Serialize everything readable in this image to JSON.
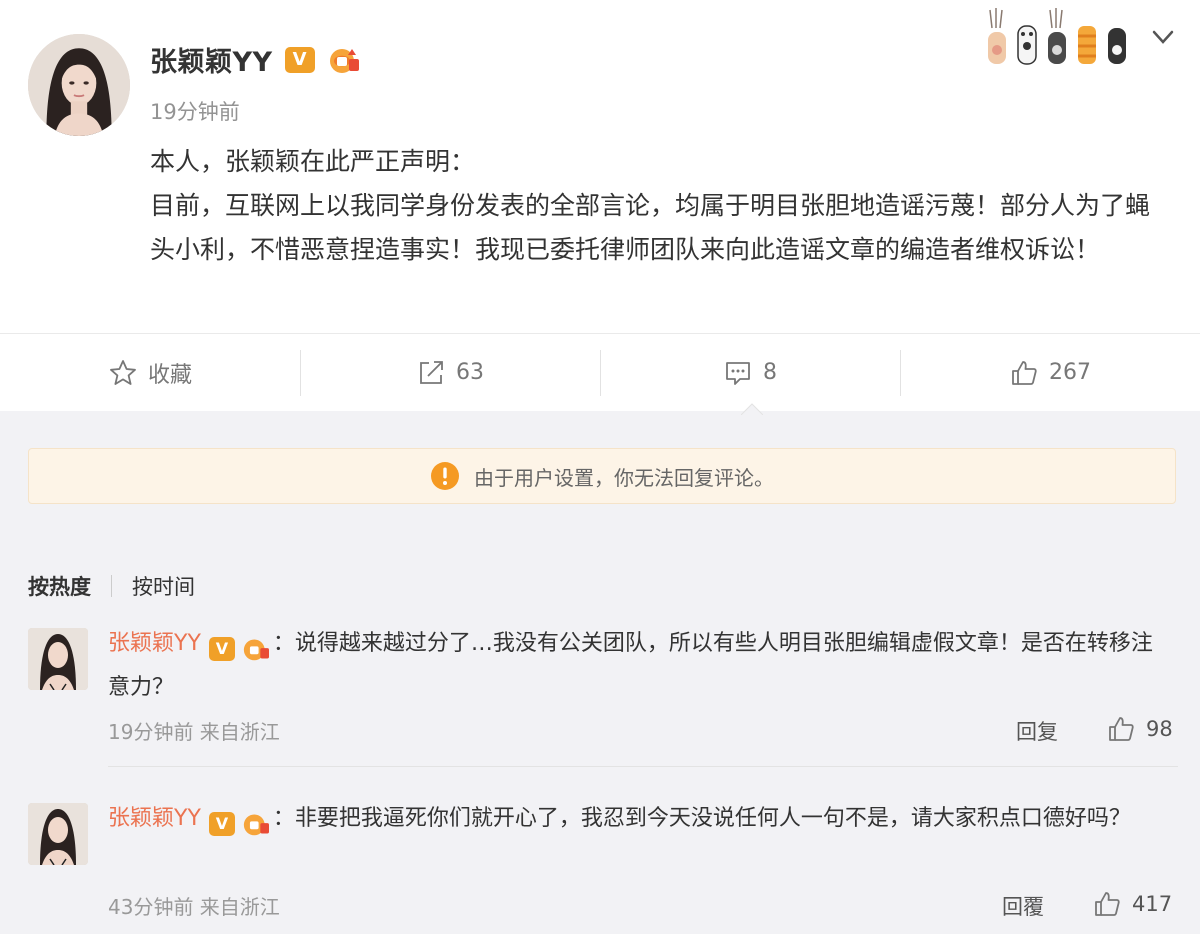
{
  "post": {
    "author": "张颖颖YY",
    "time": "19分钟前",
    "lines": [
      "本人，张颖颖在此严正声明：",
      "目前，互联网上以我同学身份发表的全部言论，均属于明目张胆地造谣污蔑！部分人为了蝇头小利，不惜恶意捏造事实！我现已委托律师团队来向此造谣文章的编造者维权诉讼！"
    ]
  },
  "actions": {
    "favorite": "收藏",
    "repost": "63",
    "comment": "8",
    "like": "267"
  },
  "notice": "由于用户设置，你无法回复评论。",
  "sort": {
    "hot": "按热度",
    "time": "按时间"
  },
  "comments": [
    {
      "name": "张颖颖YY",
      "text": "：说得越来越过分了…我没有公关团队，所以有些人明目张胆编辑虚假文章！是否在转移注意力？",
      "meta": "19分钟前 来自浙江",
      "reply": "回复",
      "likes": "98"
    },
    {
      "name": "张颖颖YY",
      "text": "：非要把我逼死你们就开心了，我忍到今天没说任何人一句不是，请大家积点口德好吗？",
      "meta": "43分钟前 来自浙江",
      "reply": "回覆",
      "likes": "417"
    }
  ],
  "icons": {
    "verified": "V",
    "medal": "fan-medal-icon"
  },
  "colors": {
    "name_link": "#eb7350",
    "verified_badge": "#f0a028",
    "notice_bg": "#fdf4e7",
    "warn_icon": "#f59a23"
  }
}
